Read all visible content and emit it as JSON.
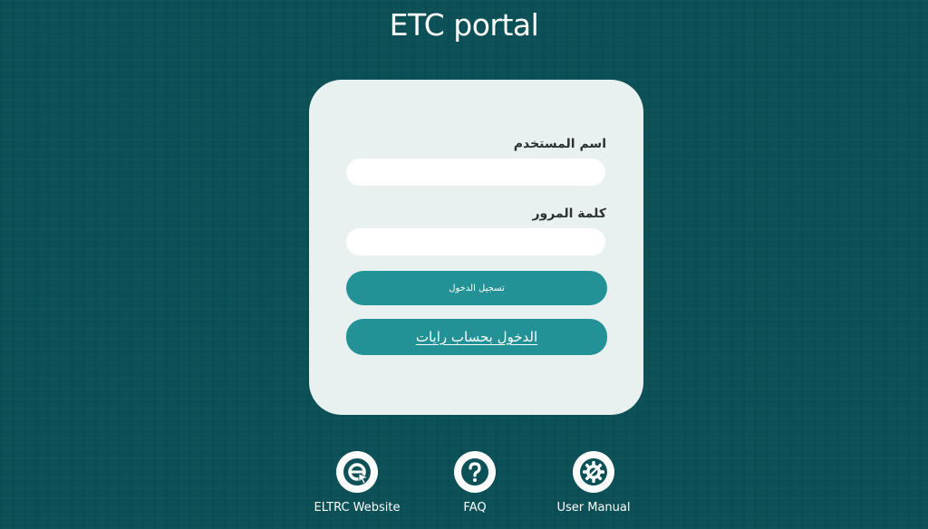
{
  "header": {
    "title": "ETC portal"
  },
  "login": {
    "username_label": "اسم المستخدم",
    "username_value": "",
    "password_label": "كلمة المرور",
    "password_value": "",
    "login_button": "تسجيل الدخول",
    "rayat_button": "الدخول بحساب رايات"
  },
  "footer": {
    "links": [
      {
        "label": "ELTRC Website",
        "icon": "eltrc-logo-icon"
      },
      {
        "label": "FAQ",
        "icon": "question-mark-icon"
      },
      {
        "label": "User Manual",
        "icon": "gear-wrench-icon"
      }
    ]
  },
  "colors": {
    "background": "#0b5157",
    "card": "#e9f0f0",
    "button": "#229297"
  }
}
